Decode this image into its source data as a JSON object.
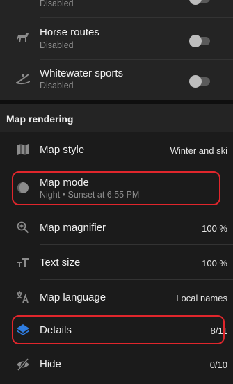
{
  "routes": [
    {
      "title": "",
      "status": "Disabled"
    },
    {
      "title": "Horse routes",
      "status": "Disabled"
    },
    {
      "title": "Whitewater sports",
      "status": "Disabled"
    }
  ],
  "section_title": "Map rendering",
  "map_style": {
    "label": "Map style",
    "value": "Winter and ski"
  },
  "map_mode": {
    "label": "Map mode",
    "subtitle": "Night • Sunset at 6:55 PM"
  },
  "map_magnifier": {
    "label": "Map magnifier",
    "value": "100 %"
  },
  "text_size": {
    "label": "Text size",
    "value": "100 %"
  },
  "map_language": {
    "label": "Map language",
    "value": "Local names"
  },
  "details": {
    "label": "Details",
    "value": "8/11"
  },
  "hide": {
    "label": "Hide",
    "value": "0/10"
  },
  "colors": {
    "accent_blue": "#2f7de1",
    "highlight_red": "#e0262c"
  }
}
